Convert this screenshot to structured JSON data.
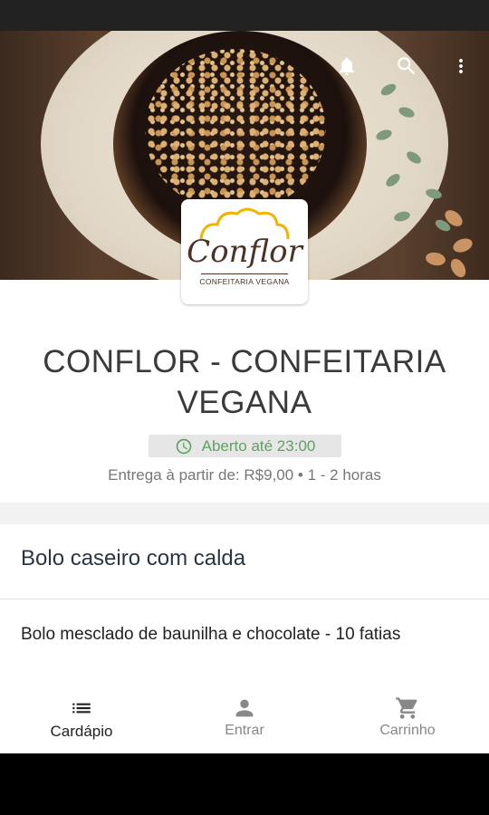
{
  "header": {
    "icons": [
      "bell-icon",
      "search-icon",
      "more-vert-icon"
    ]
  },
  "logo": {
    "name": "Conflor",
    "tagline": "CONFEITARIA VEGANA"
  },
  "store": {
    "name": "CONFLOR - CONFEITARIA VEGANA",
    "status": "Aberto até 23:00",
    "delivery": "Entrega à partir de: R$9,00 • 1 - 2 horas"
  },
  "menu": {
    "section_title": "Bolo caseiro com calda",
    "items": [
      {
        "title": "Bolo mesclado de baunilha e chocolate - 10 fatias"
      }
    ]
  },
  "nav": {
    "items": [
      {
        "label": "Cardápio",
        "icon": "list-icon"
      },
      {
        "label": "Entrar",
        "icon": "person-icon"
      },
      {
        "label": "Carrinho",
        "icon": "cart-icon"
      }
    ]
  },
  "colors": {
    "status_green": "#5da45e",
    "title_text": "#3a3a3a",
    "section_text": "#2a3542"
  }
}
